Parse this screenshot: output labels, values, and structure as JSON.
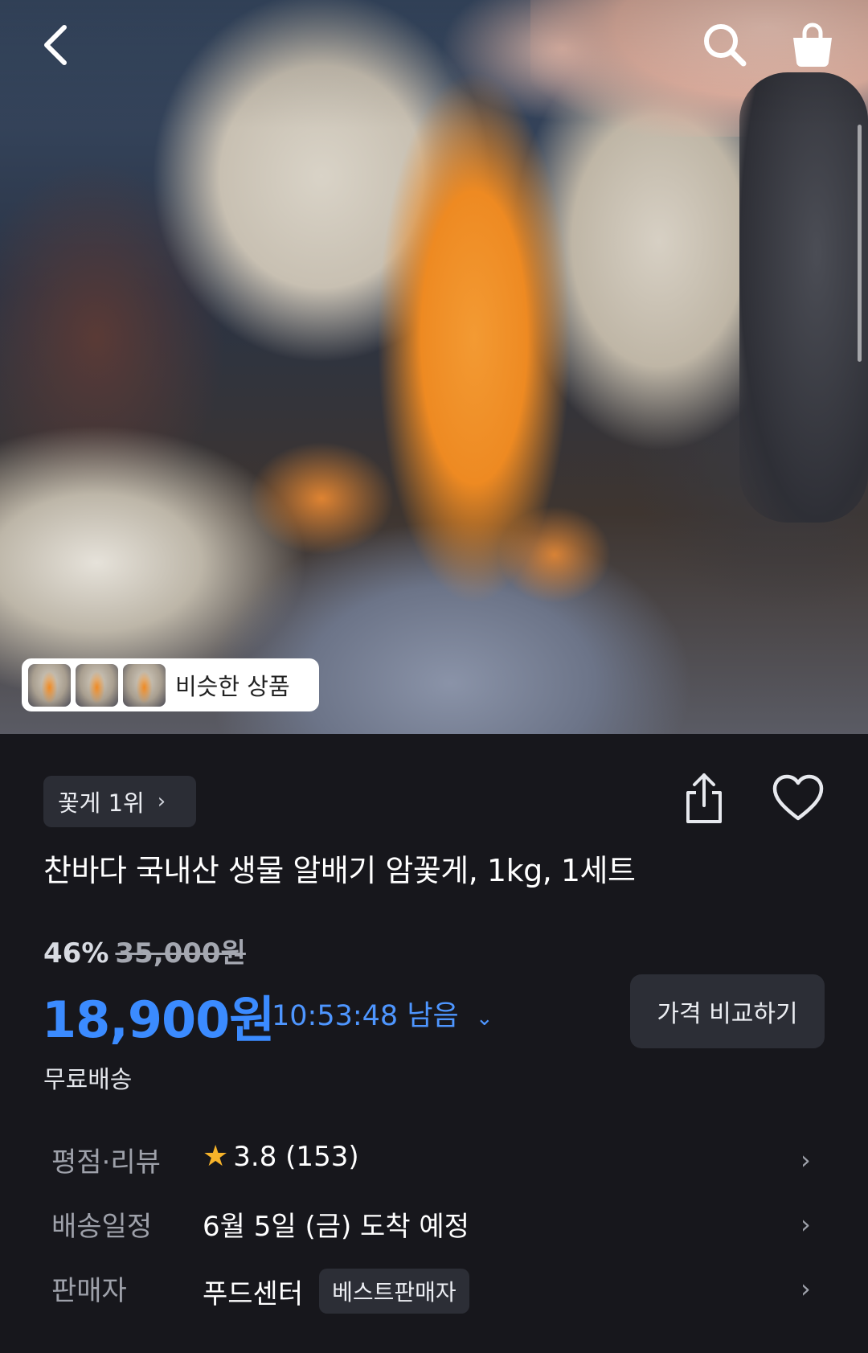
{
  "hero": {
    "similar_label": "비슷한 상품"
  },
  "product": {
    "rank_label": "꽃게 1위",
    "title": "찬바다 국내산 생물 알배기 암꽃게, 1kg, 1세트",
    "discount_rate": "46%",
    "original_price": "35,000원",
    "price": "18,900원",
    "timer": "10:53:48 남음",
    "compare_label": "가격 비교하기",
    "shipping": "무료배송"
  },
  "details": {
    "rating": {
      "label": "평점·리뷰",
      "score": "3.8",
      "count": "(153)"
    },
    "delivery": {
      "label": "배송일정",
      "value": "6월 5일 (금) 도착 예정"
    },
    "seller": {
      "label": "판매자",
      "value": "푸드센터",
      "badge": "베스트판매자"
    }
  },
  "colors": {
    "background": "#17171c",
    "price_accent": "#3b8bff",
    "star": "#f6b32a",
    "chip_bg": "#2c2e36"
  },
  "icons": [
    "back-arrow-icon",
    "search-icon",
    "shopping-bag-icon",
    "share-icon",
    "heart-icon",
    "chevron-right-icon",
    "chevron-down-icon",
    "star-icon"
  ]
}
